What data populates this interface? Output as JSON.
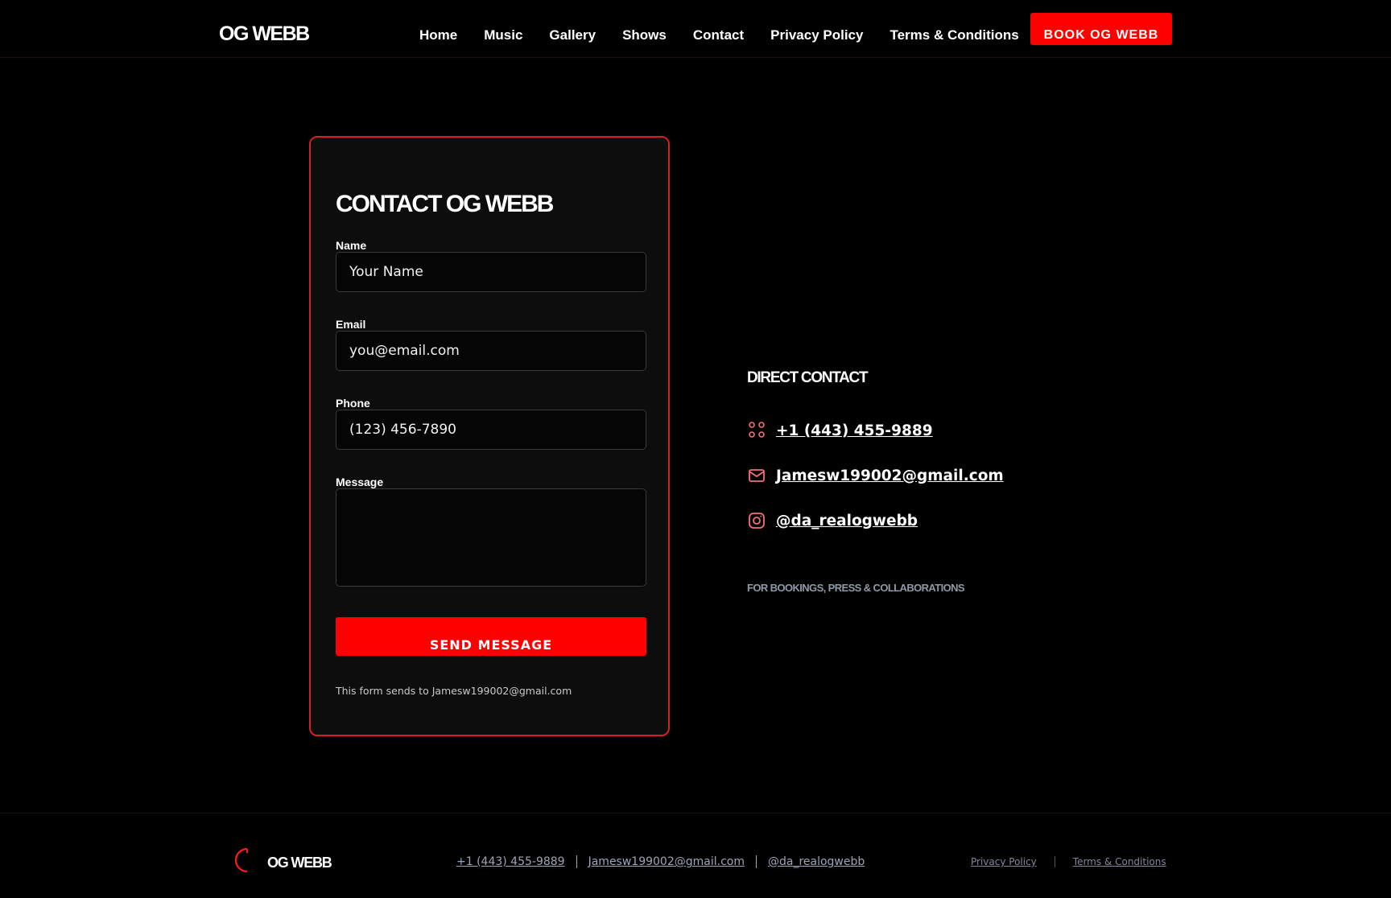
{
  "header": {
    "logo": "OG WEBB",
    "nav": [
      "Home",
      "Music",
      "Gallery",
      "Shows",
      "Contact",
      "Privacy Policy",
      "Terms & Conditions"
    ],
    "book_button": "BOOK OG WEBB"
  },
  "form": {
    "title": "CONTACT OG WEBB",
    "name_label": "Name",
    "name_placeholder": "Your Name",
    "email_label": "Email",
    "email_placeholder": "you@email.com",
    "phone_label": "Phone",
    "phone_placeholder": "(123) 456-7890",
    "message_label": "Message",
    "message_placeholder": "",
    "send_button": "SEND MESSAGE",
    "note": "This form sends to Jamesw199002@gmail.com"
  },
  "direct_contact": {
    "title": "DIRECT CONTACT",
    "phone": "+1 (443) 455-9889",
    "email": "Jamesw199002@gmail.com",
    "instagram": "@da_realogwebb",
    "note": "FOR BOOKINGS, PRESS & COLLABORATIONS",
    "phone_icon": "phone-dots-icon",
    "email_icon": "mail-icon",
    "instagram_icon": "instagram-icon"
  },
  "footer": {
    "logo": "OG WEBB",
    "logo_icon": "crescent-logo-icon",
    "phone": "+1 (443) 455-9889",
    "email": "Jamesw199002@gmail.com",
    "instagram": "@da_realogwebb",
    "privacy": "Privacy Policy",
    "terms": "Terms & Conditions"
  },
  "colors": {
    "accent": "#ff0000",
    "card_border": "#d42020",
    "icon": "#f2707a",
    "muted": "#8f9aa8"
  }
}
